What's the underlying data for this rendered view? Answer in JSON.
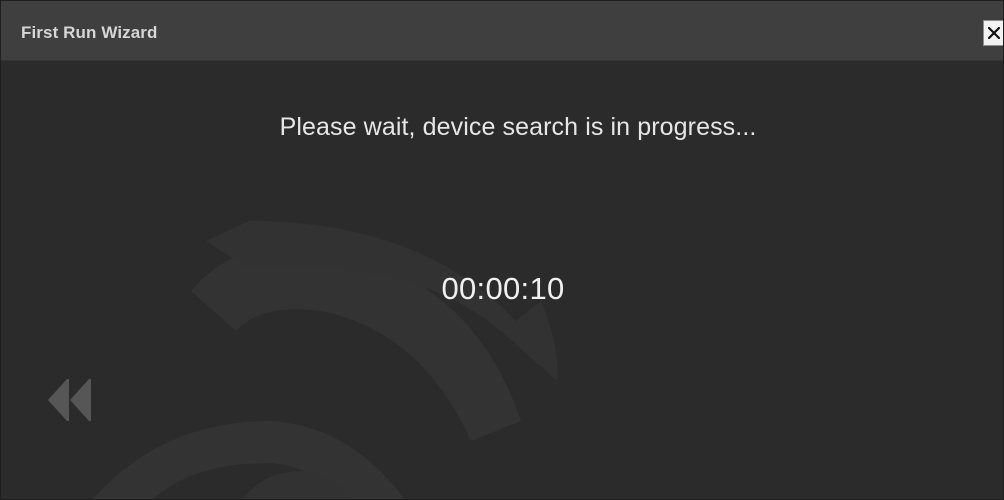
{
  "window": {
    "title": "First Run Wizard"
  },
  "controls": {
    "close_glyph": "✕",
    "back_icon": "double-chevron-left-icon"
  },
  "content": {
    "message": "Please wait, device search is in progress...",
    "elapsed_time": "00:00:10"
  },
  "colors": {
    "background": "#2b2b2b",
    "title_bar": "#3f3f3f",
    "title_text": "#d6d6d6",
    "message_text": "#e6e6e6",
    "watermark": "#353535",
    "back_icon": "#555555"
  }
}
